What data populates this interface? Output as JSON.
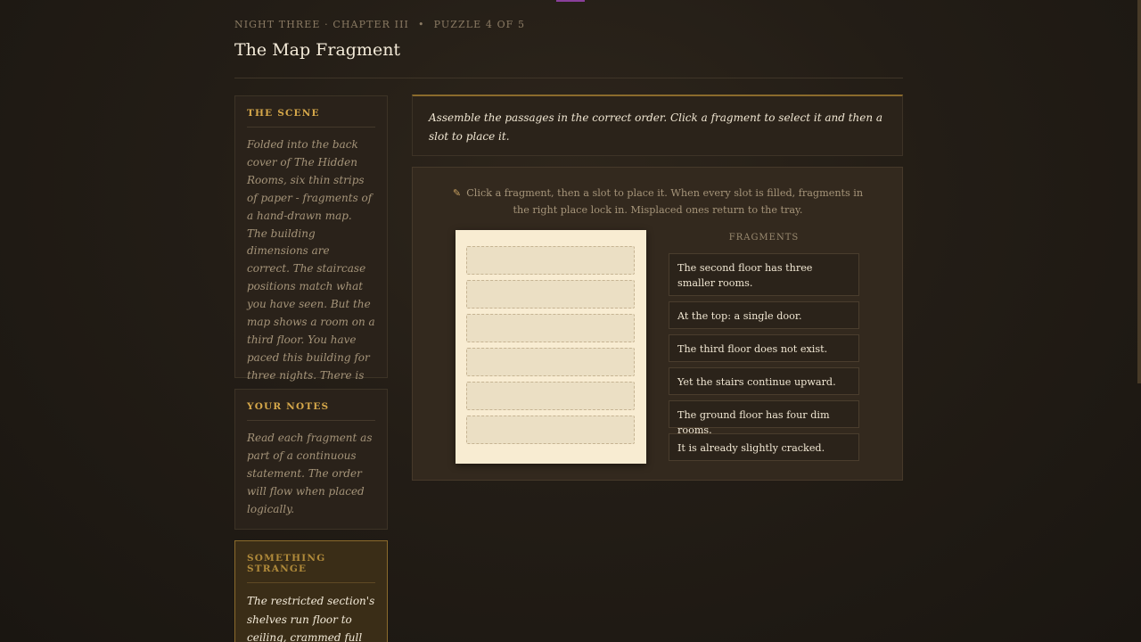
{
  "header": {
    "chapter": "NIGHT THREE · CHAPTER III",
    "separator": "•",
    "puzzle_count": "PUZZLE 4 OF 5",
    "title": "The Map Fragment"
  },
  "sidebar": {
    "scene": {
      "heading": "THE SCENE",
      "text": "Folded into the back cover of The Hidden Rooms, six thin strips of paper - fragments of a hand-drawn map. The building dimensions are correct. The staircase positions match what you have seen. But the map shows a room on a third floor. You have paced this building for three nights. There is no third floor."
    },
    "notes": {
      "heading": "YOUR NOTES",
      "text": "Read each fragment as part of a continuous statement. The order will flow when placed logically."
    },
    "strange": {
      "heading": "SOMETHING STRANGE",
      "text": "The restricted section's shelves run floor to ceiling, crammed full of books in a"
    }
  },
  "instruction": "Assemble the passages in the correct order. Click a fragment to select it and then a slot to place it.",
  "puzzle": {
    "hint_icon": "pen-icon",
    "hint": "Click a fragment, then a slot to place it. When every slot is filled, fragments in the right place lock in. Misplaced ones return to the tray.",
    "slot_count": 6,
    "tray_label": "FRAGMENTS",
    "fragments": [
      "The second floor has three smaller rooms.",
      "At the top: a single door.",
      "The third floor does not exist.",
      "Yet the stairs continue upward.",
      "The ground floor has four dim rooms.",
      "It is already slightly cracked."
    ]
  },
  "colors": {
    "accent_gold": "#d6a84a",
    "background": "#231d16",
    "paper": "#f8ecd2"
  }
}
